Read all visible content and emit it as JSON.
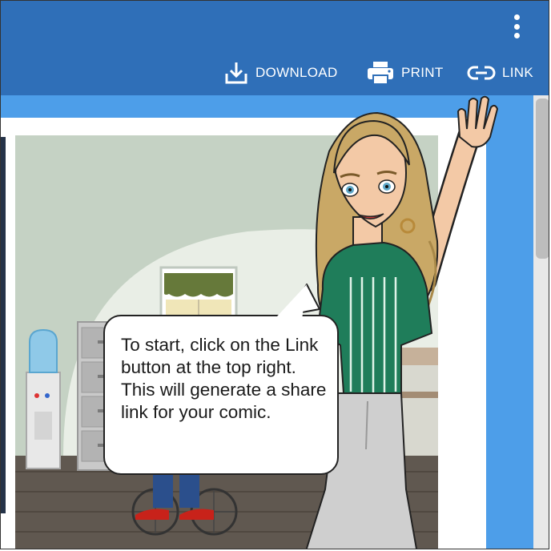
{
  "toolbar": {
    "download_label": "DOWNLOAD",
    "print_label": "PRINT",
    "link_label": "LINK",
    "download_icon": "download-icon",
    "print_icon": "printer-icon",
    "link_icon": "link-icon",
    "menu_icon": "more-vert-icon"
  },
  "comic": {
    "speech_bubble_text": "To start, click on the Link button at the top right. This will generate a share link for your comic."
  },
  "colors": {
    "toolbar_bg": "#2f6fb8",
    "workspace_bg": "#4d9ee9",
    "wall": "#c5d2c4",
    "floor": "#605850",
    "shirt_green": "#1f7d5a",
    "hair": "#c9a866"
  }
}
